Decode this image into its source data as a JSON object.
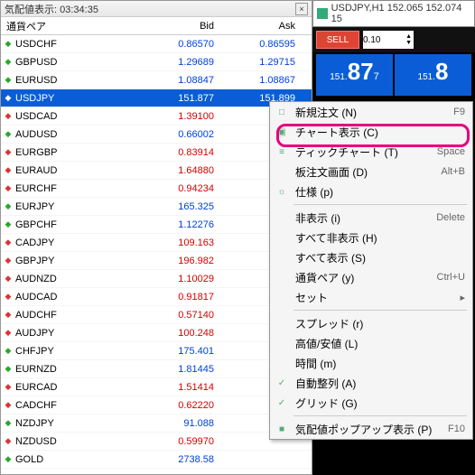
{
  "titlebar": {
    "text": "気配値表示: 03:34:35"
  },
  "header": {
    "pair": "通貨ペア",
    "bid": "Bid",
    "ask": "Ask"
  },
  "rows": [
    {
      "dir": "up",
      "pair": "USDCHF",
      "bid": "0.86570",
      "ask": "0.86595",
      "c": "blue"
    },
    {
      "dir": "up",
      "pair": "GBPUSD",
      "bid": "1.29689",
      "ask": "1.29715",
      "c": "blue"
    },
    {
      "dir": "up",
      "pair": "EURUSD",
      "bid": "1.08847",
      "ask": "1.08867",
      "c": "blue"
    },
    {
      "dir": "up",
      "pair": "USDJPY",
      "bid": "151.877",
      "ask": "151.899",
      "c": "blue",
      "sel": true
    },
    {
      "dir": "dn",
      "pair": "USDCAD",
      "bid": "1.39100",
      "ask": "",
      "c": "red"
    },
    {
      "dir": "up",
      "pair": "AUDUSD",
      "bid": "0.66002",
      "ask": "",
      "c": "blue"
    },
    {
      "dir": "dn",
      "pair": "EURGBP",
      "bid": "0.83914",
      "ask": "",
      "c": "red"
    },
    {
      "dir": "dn",
      "pair": "EURAUD",
      "bid": "1.64880",
      "ask": "",
      "c": "red"
    },
    {
      "dir": "dn",
      "pair": "EURCHF",
      "bid": "0.94234",
      "ask": "",
      "c": "red"
    },
    {
      "dir": "up",
      "pair": "EURJPY",
      "bid": "165.325",
      "ask": "",
      "c": "blue"
    },
    {
      "dir": "up",
      "pair": "GBPCHF",
      "bid": "1.12276",
      "ask": "",
      "c": "blue"
    },
    {
      "dir": "dn",
      "pair": "CADJPY",
      "bid": "109.163",
      "ask": "",
      "c": "red"
    },
    {
      "dir": "dn",
      "pair": "GBPJPY",
      "bid": "196.982",
      "ask": "",
      "c": "red"
    },
    {
      "dir": "dn",
      "pair": "AUDNZD",
      "bid": "1.10029",
      "ask": "",
      "c": "red"
    },
    {
      "dir": "dn",
      "pair": "AUDCAD",
      "bid": "0.91817",
      "ask": "",
      "c": "red"
    },
    {
      "dir": "dn",
      "pair": "AUDCHF",
      "bid": "0.57140",
      "ask": "",
      "c": "red"
    },
    {
      "dir": "dn",
      "pair": "AUDJPY",
      "bid": "100.248",
      "ask": "",
      "c": "red"
    },
    {
      "dir": "up",
      "pair": "CHFJPY",
      "bid": "175.401",
      "ask": "",
      "c": "blue"
    },
    {
      "dir": "up",
      "pair": "EURNZD",
      "bid": "1.81445",
      "ask": "",
      "c": "blue"
    },
    {
      "dir": "dn",
      "pair": "EURCAD",
      "bid": "1.51414",
      "ask": "",
      "c": "red"
    },
    {
      "dir": "dn",
      "pair": "CADCHF",
      "bid": "0.62220",
      "ask": "",
      "c": "red"
    },
    {
      "dir": "up",
      "pair": "NZDJPY",
      "bid": "91.088",
      "ask": "",
      "c": "blue"
    },
    {
      "dir": "dn",
      "pair": "NZDUSD",
      "bid": "0.59970",
      "ask": "",
      "c": "red"
    },
    {
      "dir": "up",
      "pair": "GOLD",
      "bid": "2738.58",
      "ask": "",
      "c": "blue"
    }
  ],
  "chart": {
    "title": "USDJPY,H1  152.065 152.074 15",
    "sell": "SELL",
    "qty": "0.10",
    "p1_small": "151.",
    "p1_big": "87",
    "p1_sup": "7",
    "p2_small": "151.",
    "p2_big": "8"
  },
  "menu": [
    {
      "type": "item",
      "icon": "□",
      "label": "新規注文 (N)",
      "short": "F9"
    },
    {
      "type": "item",
      "icon": "▣",
      "label": "チャート表示 (C)",
      "short": ""
    },
    {
      "type": "item",
      "icon": "≡",
      "label": "ティックチャート (T)",
      "short": "Space"
    },
    {
      "type": "item",
      "icon": "",
      "label": "板注文画面 (D)",
      "short": "Alt+B"
    },
    {
      "type": "item",
      "icon": "☼",
      "label": "仕様 (p)",
      "short": ""
    },
    {
      "type": "sep"
    },
    {
      "type": "item",
      "icon": "",
      "label": "非表示 (i)",
      "short": "Delete"
    },
    {
      "type": "item",
      "icon": "",
      "label": "すべて非表示 (H)",
      "short": ""
    },
    {
      "type": "item",
      "icon": "",
      "label": "すべて表示 (S)",
      "short": ""
    },
    {
      "type": "item",
      "icon": "",
      "label": "通貨ペア (y)",
      "short": "Ctrl+U"
    },
    {
      "type": "item",
      "icon": "",
      "label": "セット",
      "short": "▸"
    },
    {
      "type": "sep"
    },
    {
      "type": "item",
      "icon": "",
      "label": "スプレッド (r)",
      "short": ""
    },
    {
      "type": "item",
      "icon": "",
      "label": "高値/安値 (L)",
      "short": ""
    },
    {
      "type": "item",
      "icon": "",
      "label": "時間 (m)",
      "short": ""
    },
    {
      "type": "item",
      "icon": "✓",
      "label": "自動整列 (A)",
      "short": ""
    },
    {
      "type": "item",
      "icon": "✓",
      "label": "グリッド (G)",
      "short": ""
    },
    {
      "type": "sep"
    },
    {
      "type": "item",
      "icon": "■",
      "label": "気配値ポップアップ表示 (P)",
      "short": "F10"
    }
  ]
}
